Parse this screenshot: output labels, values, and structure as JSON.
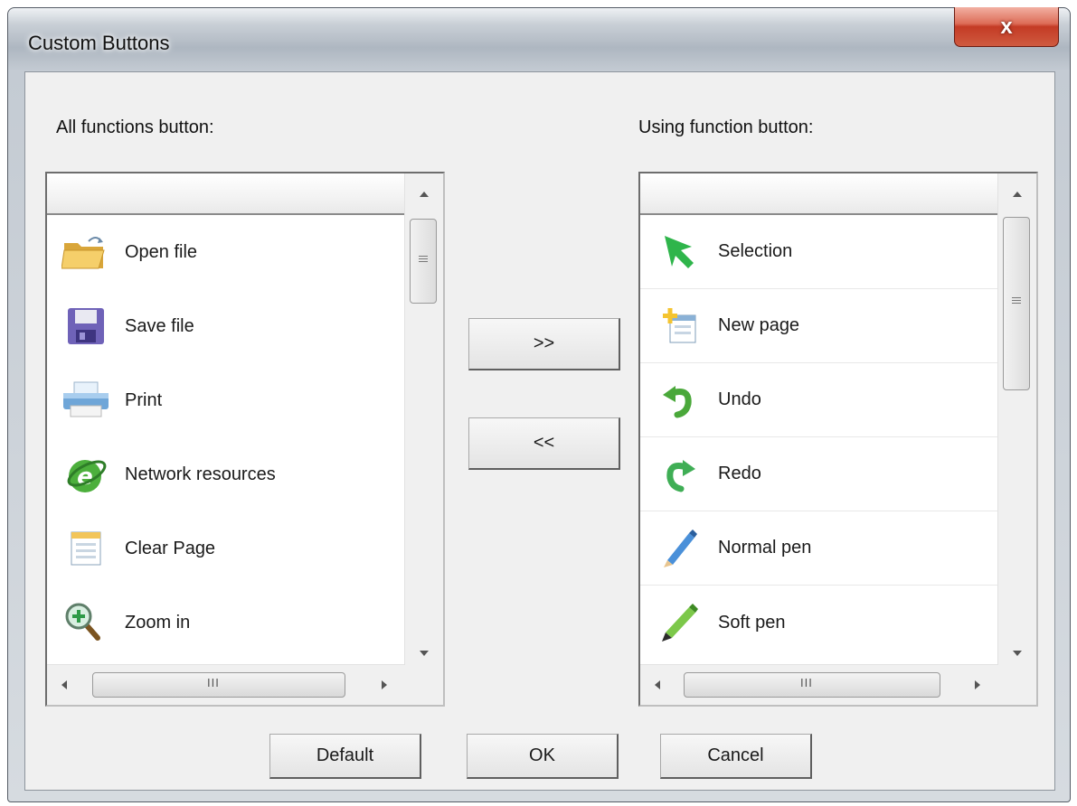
{
  "window": {
    "title": "Custom Buttons",
    "close_label": "x"
  },
  "left_panel": {
    "label": "All functions button:",
    "items": [
      {
        "label": "Open file",
        "icon": "open-folder-icon"
      },
      {
        "label": "Save file",
        "icon": "floppy-disk-icon"
      },
      {
        "label": "Print",
        "icon": "printer-icon"
      },
      {
        "label": "Network resources",
        "icon": "internet-explorer-icon"
      },
      {
        "label": "Clear Page",
        "icon": "clear-page-icon"
      },
      {
        "label": "Zoom in",
        "icon": "zoom-in-icon"
      }
    ],
    "scroll_grip": "III"
  },
  "right_panel": {
    "label": "Using function button:",
    "items": [
      {
        "label": "Selection",
        "icon": "selection-arrow-icon"
      },
      {
        "label": "New page",
        "icon": "new-page-icon"
      },
      {
        "label": "Undo",
        "icon": "undo-icon"
      },
      {
        "label": "Redo",
        "icon": "redo-icon"
      },
      {
        "label": "Normal pen",
        "icon": "normal-pen-icon"
      },
      {
        "label": "Soft pen",
        "icon": "soft-pen-icon"
      }
    ],
    "scroll_grip": "III"
  },
  "transfer": {
    "add_label": ">>",
    "remove_label": "<<"
  },
  "footer": {
    "default_label": "Default",
    "ok_label": "OK",
    "cancel_label": "Cancel"
  }
}
